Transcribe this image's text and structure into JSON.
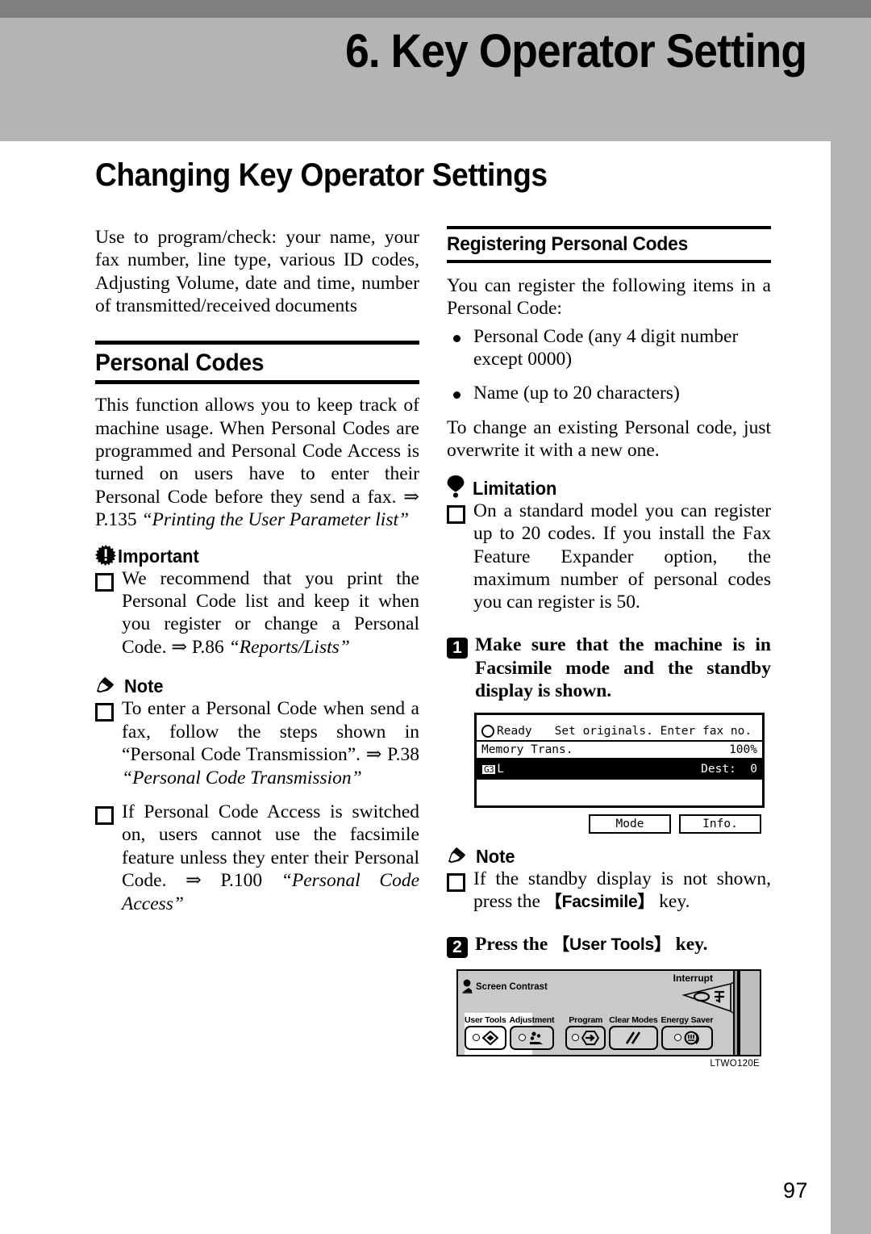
{
  "header": {
    "chapter_title": "6. Key Operator Setting"
  },
  "page": {
    "heading": "Changing Key Operator Settings",
    "page_number": "97"
  },
  "left_column": {
    "intro": "Use to program/check: your name, your fax number, line type, various ID codes, Adjusting Volume, date and time, number of transmitted/received documents",
    "section": {
      "title": "Personal Codes",
      "body_plain": "This function allows you to keep track of machine usage. When Personal Codes are programmed and Personal Code Access is turned on users have to enter their Personal Code before they send a fax. ⇒ P.135 ",
      "body_italic": "“Printing the User Parameter list”"
    },
    "important": {
      "icon": "important-burst-icon",
      "label": "Important",
      "items": [
        {
          "plain": "We recommend that you print the Personal Code list and keep it when you register or change a Personal Code. ⇒ P.86 ",
          "italic": "“Reports/Lists”"
        }
      ]
    },
    "note": {
      "icon": "note-pencil-icon",
      "label": "Note",
      "items": [
        {
          "plain": "To enter a Personal Code when send a fax, follow the steps shown in “Personal Code Transmission”. ⇒ P.38 ",
          "italic": "“Personal Code Transmission”"
        },
        {
          "plain": "If Personal Code Access is switched on, users cannot use the facsimile feature unless they enter their Personal Code. ⇒ P.100 ",
          "italic": "“Personal Code Access”"
        }
      ]
    }
  },
  "right_column": {
    "sub_section": {
      "title": "Registering Personal Codes",
      "intro": "You can register the following items in a Personal Code:",
      "bullets": [
        "Personal Code (any 4 digit number except 0000)",
        "Name (up to 20 characters)"
      ],
      "after_bullets": "To change an existing Personal code, just overwrite it with a new one."
    },
    "limitation": {
      "icon": "limitation-exclamation-icon",
      "label": "Limitation",
      "items": [
        "On a standard model you can register up to 20 codes. If you install the Fax Feature Expander option, the maximum number of personal codes you can register is 50."
      ]
    },
    "steps": [
      {
        "number": "1",
        "text": "Make sure that the machine is in Facsimile mode and the standby display is shown."
      },
      {
        "number": "2",
        "text_before": "Press the ",
        "keycap": "【User Tools】",
        "text_after": " key."
      }
    ],
    "lcd_figure": {
      "status_label": "Ready",
      "message": "Set originals. Enter fax no.",
      "mode_label": "Memory Trans.",
      "percent": "100%",
      "line_badge": "G3",
      "line_suffix": "L",
      "dest_label": "Dest:",
      "dest_value": "0",
      "buttons": [
        "Mode",
        "Info."
      ]
    },
    "note": {
      "icon": "note-pencil-icon",
      "label": "Note",
      "items": [
        {
          "before": "If the standby display is not shown, press the ",
          "keycap": "【Facsimile】",
          "after": " key."
        }
      ]
    },
    "panel_figure": {
      "interrupt_label": "Interrupt",
      "screen_contrast_label": "Screen Contrast",
      "keys": [
        {
          "label": "User Tools",
          "icon": "diamond-icon"
        },
        {
          "label": "Adjustment",
          "icon": "adjustment-icon"
        },
        {
          "label": "Program",
          "icon": "program-arrow-icon"
        },
        {
          "label": "Clear Modes",
          "icon": "clear-modes-slash-icon"
        },
        {
          "label": "Energy Saver",
          "icon": "energy-saver-icon"
        }
      ],
      "figure_code": "LTWO120E"
    }
  }
}
